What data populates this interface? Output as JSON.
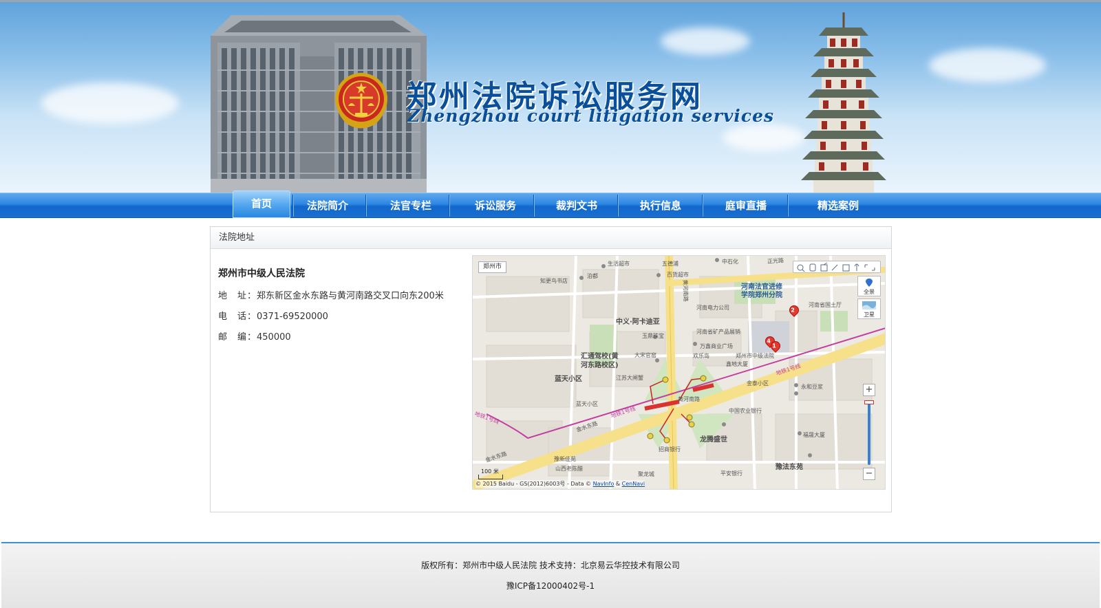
{
  "header": {
    "title_cn": "郑州法院诉讼服务网",
    "title_en": "Zhengzhou court litigation services"
  },
  "nav": {
    "items": [
      {
        "label": "首页",
        "active": true
      },
      {
        "label": "法院简介",
        "active": false
      },
      {
        "label": "法官专栏",
        "active": false
      },
      {
        "label": "诉讼服务",
        "active": false
      },
      {
        "label": "裁判文书",
        "active": false
      },
      {
        "label": "执行信息",
        "active": false
      },
      {
        "label": "庭审直播",
        "active": false
      },
      {
        "label": "精选案例",
        "active": false
      }
    ]
  },
  "panel": {
    "title": "法院地址",
    "court_name": "郑州市中级人民法院",
    "address_label": "地　址：",
    "address": "郑东新区金水东路与黄河南路交叉口向东200米",
    "phone_label": "电　话：",
    "phone": "0371-69520000",
    "postcode_label": "邮　编：",
    "postcode": "450000"
  },
  "map": {
    "city_selector": "郑州市",
    "side_buttons": [
      "全景",
      "卫星"
    ],
    "zoom_in": "+",
    "zoom_out": "−",
    "scale_label": "100 米",
    "copyright_prefix": "© 2015 Baidu - GS(2012)6003号 - Data © ",
    "copyright_link1": "NavInfo",
    "copyright_amp": " & ",
    "copyright_link2": "CenNavi",
    "labels": {
      "l1": "中义·阿卡迪亚",
      "l2": "汇通驾校(黄",
      "l3": "河东路校区)",
      "l4": "蓝天小区",
      "l5": "龙腾盛世",
      "l6": "豫法东苑",
      "l7": "河南法官进修",
      "l8": "学院郑州分院",
      "l9": "金水东路",
      "l10": "黄河南路",
      "l11": "金水东路",
      "l12": "郑州市中级法院",
      "l13": "生活超市",
      "l14": "中石化",
      "l15": "河南省国土厅",
      "l16": "万鑫商业广场",
      "l17": "永和豆浆",
      "l18": "中国农业银行",
      "l19": "福晟大厦",
      "l20": "玉鼎珠宝",
      "l21": "招商银行",
      "l22": "山西老陈醋",
      "l23": "平安银行",
      "l24": "欢乐岛",
      "l25": "蓝天小区",
      "l26": "聚龙城",
      "l27": "豫新佳苑",
      "l28": "大宋官窑",
      "l29": "江苏大闸蟹",
      "l30": "正光路",
      "l31": "五德浦",
      "l32": "知更鸟书店",
      "l33": "泊都",
      "l34": "百货超市",
      "l35": "河南电力公司",
      "l36": "河南省矿产品展销",
      "l37": "鑫地大厦",
      "l38": "金泰小区",
      "l39": "黄河南路",
      "l40": "地铁1号线",
      "l41": "地铁1号线",
      "l42": "地铁1号线"
    },
    "markers": [
      "1",
      "2",
      "4"
    ]
  },
  "footer": {
    "line1": "版权所有：郑州市中级人民法院 技术支持：北京易云华控技术有限公司",
    "line2": "豫ICP备12000402号-1"
  },
  "colors": {
    "nav_blue": "#1a6fd0",
    "title_blue": "#0a4f9a",
    "footer_line": "#3d8fd8"
  }
}
